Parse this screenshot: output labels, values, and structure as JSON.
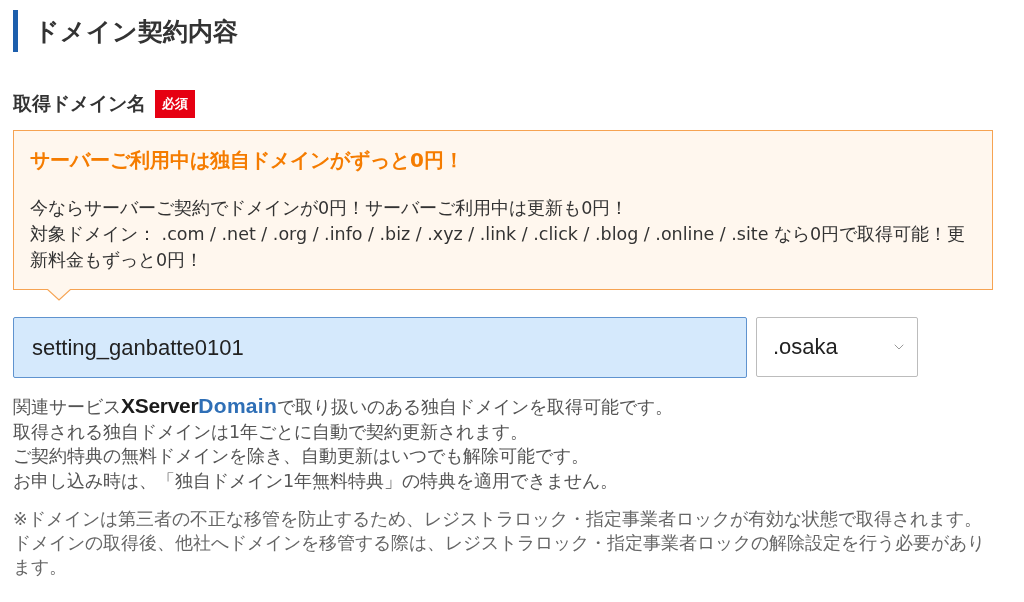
{
  "section": {
    "title": "ドメイン契約内容"
  },
  "field": {
    "label": "取得ドメイン名",
    "badge": "必須"
  },
  "notice": {
    "title": "サーバーご利用中は独自ドメインがずっと0円！",
    "paragraphs": [
      "今ならサーバーご契約でドメインが0円！サーバーご利用中は更新も0円！",
      "対象ドメイン： .com / .net / .org / .info / .biz / .xyz / .link / .click / .blog / .online / .site なら0円で取得可能！更新料金もずっと0円！"
    ]
  },
  "domain_input": {
    "value": "setting_ganbatte0101"
  },
  "tld_select": {
    "value": ".osaka"
  },
  "help": {
    "service_lead": "関連サービス",
    "service_logo": {
      "brand": "XServer",
      "product": "Domain"
    },
    "service_tail": "で取り扱いのある独自ドメインを取得可能です。",
    "lines": [
      "取得される独自ドメインは1年ごとに自動で契約更新されます。",
      "ご契約特典の無料ドメインを除き、自動更新はいつでも解除可能です。",
      "お申し込み時は、「独自ドメイン1年無料特典」の特典を適用できません。"
    ]
  },
  "notes": [
    "※ドメインは第三者の不正な移管を防止するため、レジストラロック・指定事業者ロックが有効な状態で取得されます。",
    "ドメインの取得後、他社へドメインを移管する際は、レジストラロック・指定事業者ロックの解除設定を行う必要があります。"
  ]
}
